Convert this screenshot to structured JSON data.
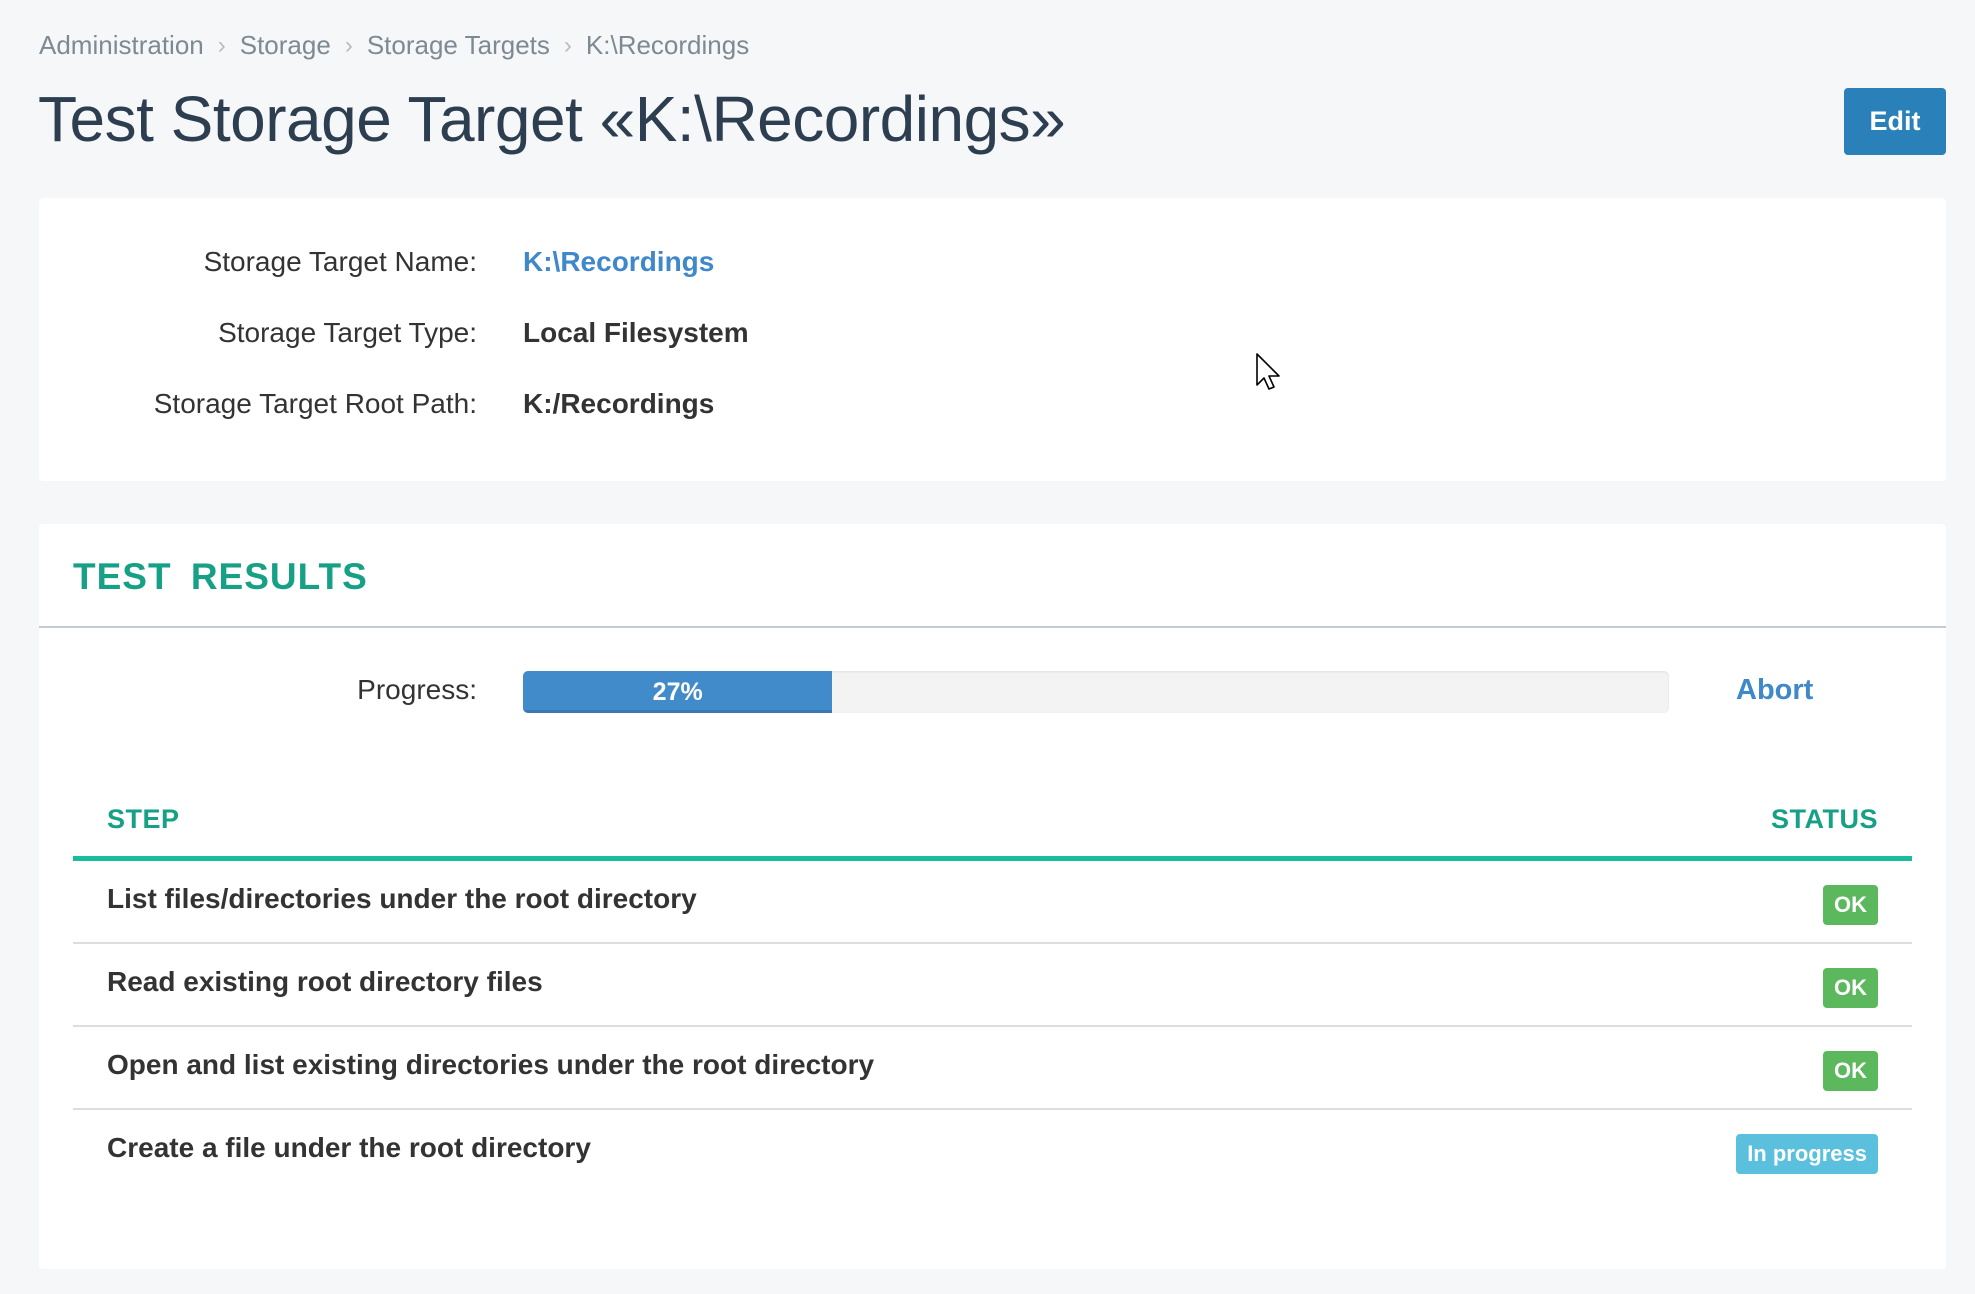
{
  "breadcrumb": [
    {
      "label": "Administration"
    },
    {
      "label": "Storage"
    },
    {
      "label": "Storage Targets"
    },
    {
      "label": "K:\\Recordings"
    }
  ],
  "breadcrumb_separator_icon": "chevron-right-icon",
  "header": {
    "title": "Test Storage Target «K:\\Recordings»",
    "edit_label": "Edit"
  },
  "info": {
    "name_label": "Storage Target Name:",
    "name_value": "K:\\Recordings",
    "type_label": "Storage Target Type:",
    "type_value": "Local Filesystem",
    "root_label": "Storage Target Root Path:",
    "root_value": "K:/Recordings"
  },
  "results": {
    "title": "TEST RESULTS",
    "progress_label": "Progress:",
    "progress_percent": 27,
    "progress_text": "27%",
    "abort_label": "Abort",
    "columns": {
      "step": "STEP",
      "status": "STATUS"
    },
    "steps": [
      {
        "step": "List files/directories under the root directory",
        "status": "OK",
        "state": "ok"
      },
      {
        "step": "Read existing root directory files",
        "status": "OK",
        "state": "ok"
      },
      {
        "step": "Open and list existing directories under the root directory",
        "status": "OK",
        "state": "ok"
      },
      {
        "step": "Create a file under the root directory",
        "status": "In progress",
        "state": "progress"
      }
    ]
  },
  "colors": {
    "primary": "#2a80b9",
    "link": "#3f88c9",
    "accent": "#16a085",
    "accent_line": "#1abc9c",
    "ok": "#5cb85c",
    "in_progress": "#5bc0de",
    "progress_fill": "#428bca"
  }
}
